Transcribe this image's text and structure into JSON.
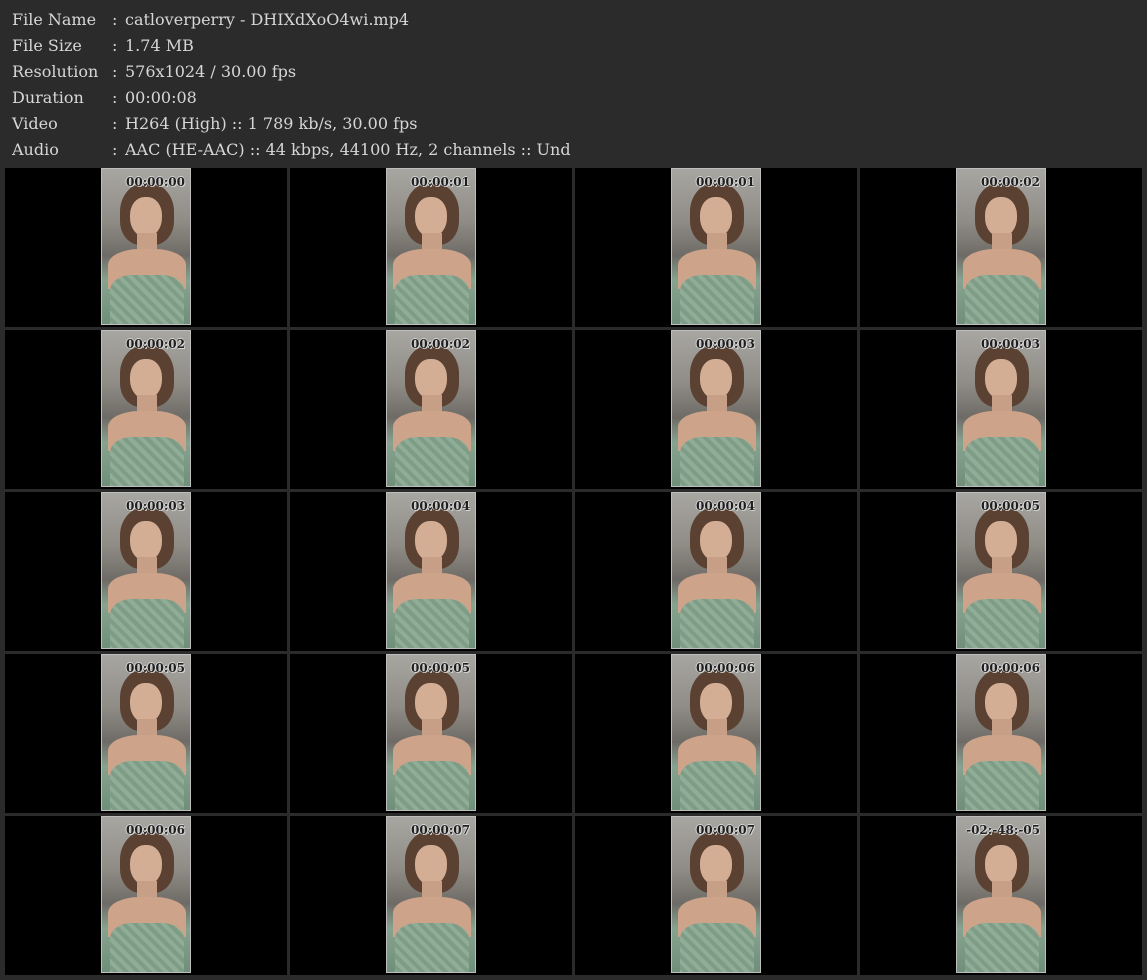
{
  "meta": [
    {
      "label": "File Name",
      "separator": ":",
      "value": "catloverperry - DHIXdXoO4wi.mp4"
    },
    {
      "label": "File Size",
      "separator": ":",
      "value": "1.74 MB"
    },
    {
      "label": "Resolution",
      "separator": ":",
      "value": "576x1024 / 30.00 fps"
    },
    {
      "label": "Duration",
      "separator": ":",
      "value": "00:00:08"
    },
    {
      "label": "Video",
      "separator": ":",
      "value": "H264 (High) :: 1 789 kb/s, 30.00 fps"
    },
    {
      "label": "Audio",
      "separator": ":",
      "value": "AAC (HE-AAC) :: 44 kbps, 44100 Hz, 2 channels :: Und"
    }
  ],
  "frames": [
    {
      "timestamp": "00:00:00"
    },
    {
      "timestamp": "00:00:01"
    },
    {
      "timestamp": "00:00:01"
    },
    {
      "timestamp": "00:00:02"
    },
    {
      "timestamp": "00:00:02"
    },
    {
      "timestamp": "00:00:02"
    },
    {
      "timestamp": "00:00:03"
    },
    {
      "timestamp": "00:00:03"
    },
    {
      "timestamp": "00:00:03"
    },
    {
      "timestamp": "00:00:04"
    },
    {
      "timestamp": "00:00:04"
    },
    {
      "timestamp": "00:00:05"
    },
    {
      "timestamp": "00:00:05"
    },
    {
      "timestamp": "00:00:05"
    },
    {
      "timestamp": "00:00:06"
    },
    {
      "timestamp": "00:00:06"
    },
    {
      "timestamp": "00:00:06"
    },
    {
      "timestamp": "00:00:07"
    },
    {
      "timestamp": "00:00:07"
    },
    {
      "timestamp": "-02:-48:-05"
    }
  ]
}
